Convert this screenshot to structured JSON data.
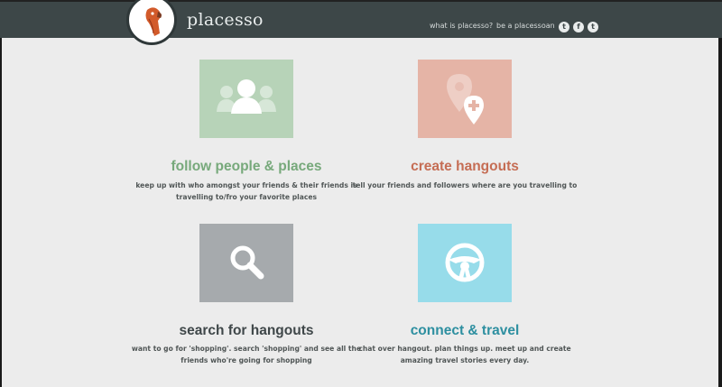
{
  "header": {
    "brand": "placesso",
    "nav": {
      "what_is": "what is placesso?",
      "be_a": "be a placessoan"
    },
    "social": [
      {
        "icon": "tumblr-icon",
        "glyph": "t"
      },
      {
        "icon": "facebook-icon",
        "glyph": "f"
      },
      {
        "icon": "twitter-icon",
        "glyph": "t"
      }
    ]
  },
  "features": [
    {
      "title": "follow people & places",
      "description": "keep up with who amongst your friends & their friends is travelling to/fro your favorite places",
      "icon": "people-icon",
      "color": "#b7d3b8",
      "title_color": "#77a97b"
    },
    {
      "title": "create hangouts",
      "description": "tell your friends and followers where are you travelling to",
      "icon": "map-pin-add-icon",
      "color": "#e5b4a6",
      "title_color": "#c56d54"
    },
    {
      "title": "search for hangouts",
      "description": "want to go for 'shopping'. search 'shopping' and see all the friends who're going for shopping",
      "icon": "search-icon",
      "color": "#a6aaad",
      "title_color": "#3f4749"
    },
    {
      "title": "connect & travel",
      "description": "chat over hangout. plan things up. meet up and create amazing travel stories every day.",
      "icon": "steering-wheel-icon",
      "color": "#97dcea",
      "title_color": "#2d8fa0"
    }
  ]
}
